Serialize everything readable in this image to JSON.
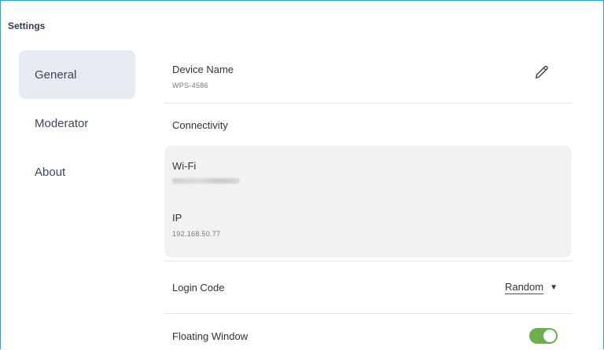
{
  "settings_title": "Settings",
  "sidebar": {
    "items": [
      {
        "label": "General",
        "active": true
      },
      {
        "label": "Moderator",
        "active": false
      },
      {
        "label": "About",
        "active": false
      }
    ]
  },
  "device": {
    "label": "Device Name",
    "value": "WPS-4586",
    "edit_icon": "pencil-icon"
  },
  "connectivity": {
    "label": "Connectivity",
    "wifi_label": "Wi-Fi",
    "wifi_value_obscured": true,
    "ip_label": "IP",
    "ip_value": "192.168.50.77"
  },
  "login_code": {
    "label": "Login Code",
    "selected": "Random",
    "dropdown_icon": "caret-down-icon"
  },
  "floating_window": {
    "label": "Floating Window",
    "enabled": true
  },
  "colors": {
    "frame_border": "#29a3d8",
    "active_nav_bg": "#e7ecf2",
    "card_bg": "#f2f2f2",
    "toggle_on": "#6ab04c"
  }
}
